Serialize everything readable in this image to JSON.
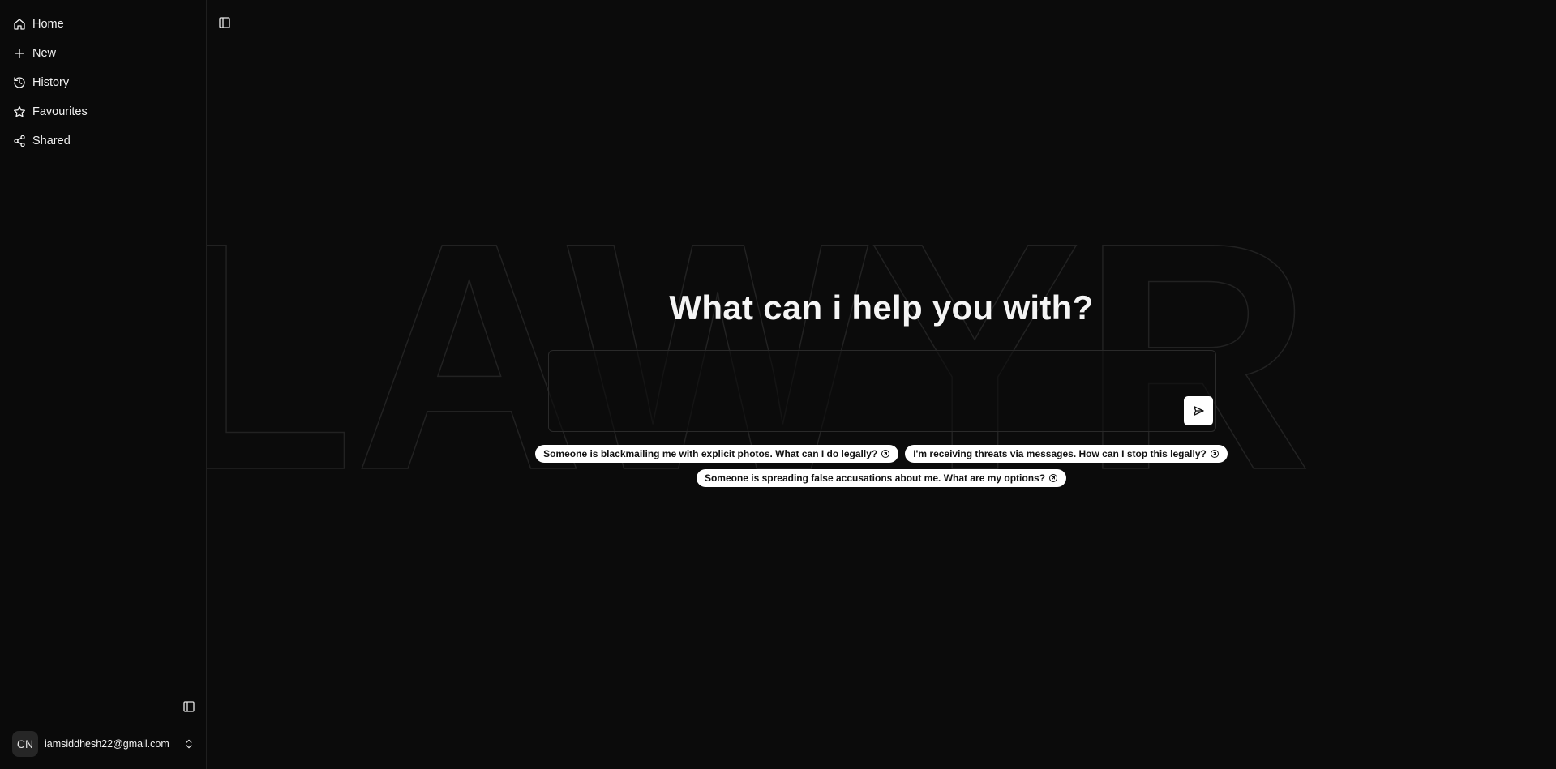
{
  "sidebar": {
    "items": [
      {
        "label": "Home",
        "icon": "home-icon"
      },
      {
        "label": "New",
        "icon": "plus-icon"
      },
      {
        "label": "History",
        "icon": "history-icon"
      },
      {
        "label": "Favourites",
        "icon": "star-icon"
      },
      {
        "label": "Shared",
        "icon": "share-icon"
      }
    ],
    "user": {
      "initials": "CN",
      "email": "iamsiddhesh22@gmail.com"
    }
  },
  "main": {
    "watermark": "LAWYR",
    "headline": "What can i help you with?",
    "prompt": {
      "value": "",
      "placeholder": ""
    },
    "suggestions": [
      "Someone is blackmailing me with explicit photos. What can I do legally?",
      "I'm receiving threats via messages. How can I stop this legally?",
      "Someone is spreading false accusations about me. What are my options?"
    ]
  },
  "colors": {
    "background": "#0b0b0b",
    "sidebar_border": "#1f1f1f",
    "text": "#f2f2f2",
    "chip_bg": "#ffffff",
    "chip_text": "#111111"
  }
}
